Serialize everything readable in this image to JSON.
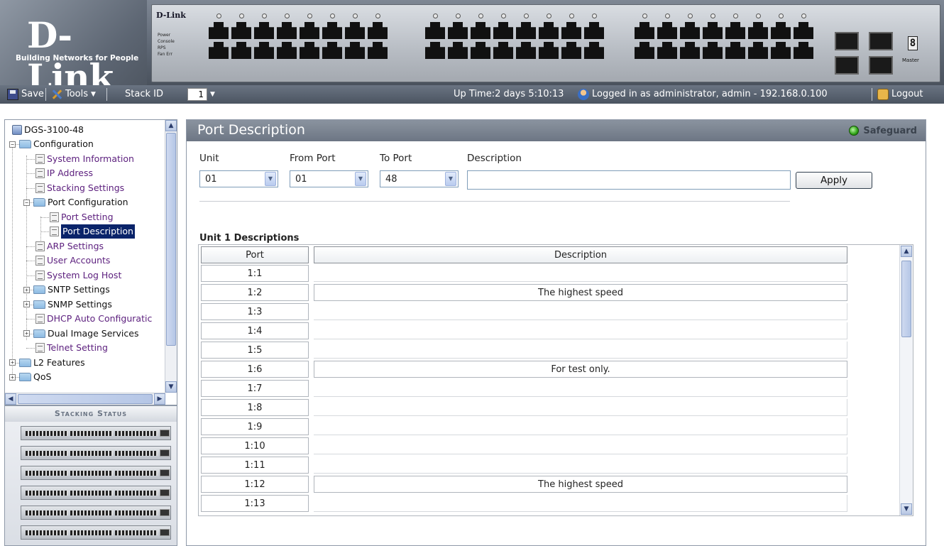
{
  "header": {
    "logo": "D-Link",
    "tagline": "Building Networks for People",
    "device_brand": "D-Link",
    "device_leds": [
      "Power",
      "Console",
      "RPS",
      "Fan Err"
    ],
    "port_groups": [
      {
        "start": 1,
        "end": 16
      },
      {
        "start": 17,
        "end": 32
      },
      {
        "start": 33,
        "end": 48
      }
    ],
    "unit_display": "8",
    "master_label": "Master"
  },
  "toolbar": {
    "save_label": "Save",
    "tools_label": "Tools",
    "stack_id_label": "Stack ID",
    "stack_id_value": "1",
    "uptime": "Up Time:2 days 5:10:13",
    "login_info": "Logged in as administrator, admin - 192.168.0.100",
    "logout_label": "Logout"
  },
  "tree": {
    "root": "DGS-3100-48",
    "items": [
      {
        "label": "Configuration",
        "type": "folder",
        "expander": "−",
        "indent": 0
      },
      {
        "label": "System Information",
        "type": "page",
        "indent": 1
      },
      {
        "label": "IP Address",
        "type": "page",
        "indent": 1
      },
      {
        "label": "Stacking Settings",
        "type": "page",
        "indent": 1
      },
      {
        "label": "Port Configuration",
        "type": "folder",
        "expander": "−",
        "indent": 1
      },
      {
        "label": "Port Setting",
        "type": "page",
        "indent": 2
      },
      {
        "label": "Port Description",
        "type": "page",
        "indent": 2,
        "selected": true
      },
      {
        "label": "ARP Settings",
        "type": "page",
        "indent": 1
      },
      {
        "label": "User Accounts",
        "type": "page",
        "indent": 1
      },
      {
        "label": "System Log Host",
        "type": "page",
        "indent": 1
      },
      {
        "label": "SNTP Settings",
        "type": "folder",
        "expander": "+",
        "indent": 1
      },
      {
        "label": "SNMP Settings",
        "type": "folder",
        "expander": "+",
        "indent": 1
      },
      {
        "label": "DHCP Auto Configuratic",
        "type": "page",
        "indent": 1
      },
      {
        "label": "Dual Image Services",
        "type": "folder",
        "expander": "+",
        "indent": 1
      },
      {
        "label": "Telnet Setting",
        "type": "page",
        "indent": 1
      },
      {
        "label": "L2 Features",
        "type": "folder",
        "expander": "+",
        "indent": 0
      },
      {
        "label": "QoS",
        "type": "folder",
        "expander": "+",
        "indent": 0
      }
    ]
  },
  "stacking": {
    "title": "Stacking Status",
    "unit_count": 6
  },
  "main": {
    "title": "Port Description",
    "safeguard_label": "Safeguard",
    "form": {
      "unit_label": "Unit",
      "unit_value": "01",
      "from_port_label": "From Port",
      "from_port_value": "01",
      "to_port_label": "To Port",
      "to_port_value": "48",
      "description_label": "Description",
      "description_value": "",
      "apply_label": "Apply"
    },
    "table": {
      "heading": "Unit 1 Descriptions",
      "columns": [
        "Port",
        "Description"
      ],
      "rows": [
        {
          "port": "1:1",
          "description": ""
        },
        {
          "port": "1:2",
          "description": "The highest speed"
        },
        {
          "port": "1:3",
          "description": ""
        },
        {
          "port": "1:4",
          "description": ""
        },
        {
          "port": "1:5",
          "description": ""
        },
        {
          "port": "1:6",
          "description": "For test only."
        },
        {
          "port": "1:7",
          "description": ""
        },
        {
          "port": "1:8",
          "description": ""
        },
        {
          "port": "1:9",
          "description": ""
        },
        {
          "port": "1:10",
          "description": ""
        },
        {
          "port": "1:11",
          "description": ""
        },
        {
          "port": "1:12",
          "description": "The highest speed"
        },
        {
          "port": "1:13",
          "description": ""
        }
      ]
    }
  },
  "colors": {
    "selected_bg": "#0a246a",
    "link_text": "#5b1e7d",
    "title_bar": "#6d7684",
    "safeguard_green": "#2fa316"
  }
}
